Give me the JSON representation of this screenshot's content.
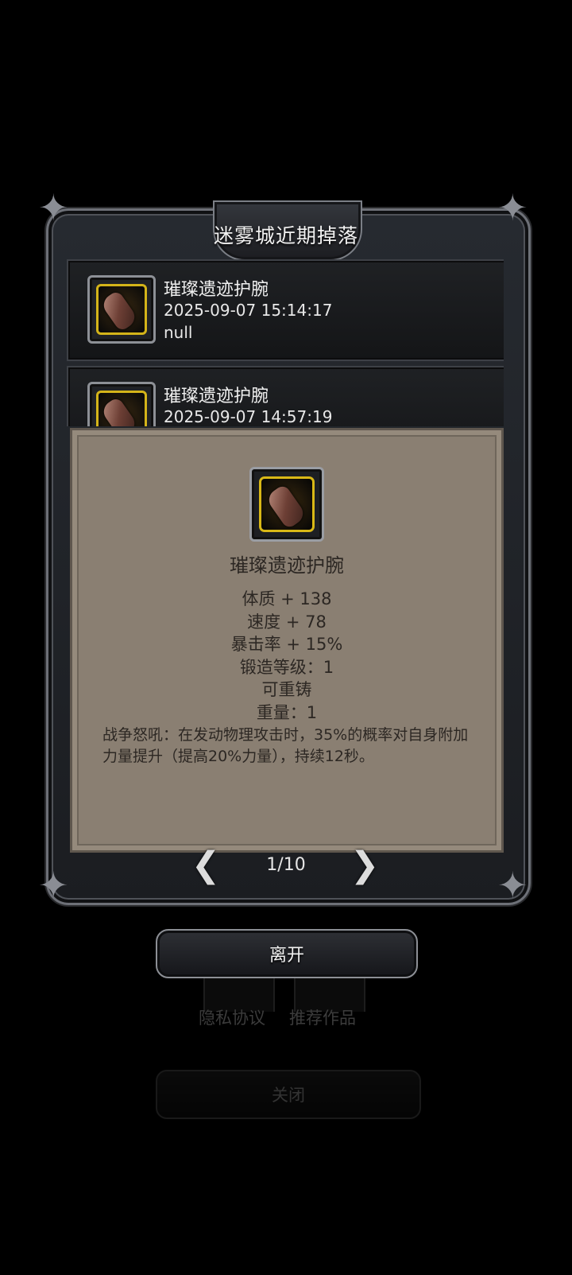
{
  "dialog": {
    "title": "迷雾城近期掉落"
  },
  "drops": [
    {
      "name": "璀璨遗迹护腕",
      "time": "2025-09-07 15:14:17",
      "extra": "null"
    },
    {
      "name": "璀璨遗迹护腕",
      "time": "2025-09-07 14:57:19"
    }
  ],
  "tooltip": {
    "name": "璀璨遗迹护腕",
    "stats": [
      "体质 + 138",
      "速度 + 78",
      "暴击率 + 15%",
      "锻造等级：1",
      "可重铸",
      "重量：1"
    ],
    "description": "战争怒吼：在发动物理攻击时，35%的概率对自身附加力量提升（提高20%力量），持续12秒。"
  },
  "pager": {
    "text": "1/10",
    "prev_icon": "chevron-left-icon",
    "next_icon": "chevron-right-icon"
  },
  "leave_button": "离开",
  "background_menu": {
    "privacy": "隐私协议",
    "recommended": "推荐作品",
    "close": "关闭"
  },
  "colors": {
    "frame_border": "#6d7077",
    "tooltip_bg": "#8a7f72",
    "icon_gold_border": "#d4b419"
  }
}
